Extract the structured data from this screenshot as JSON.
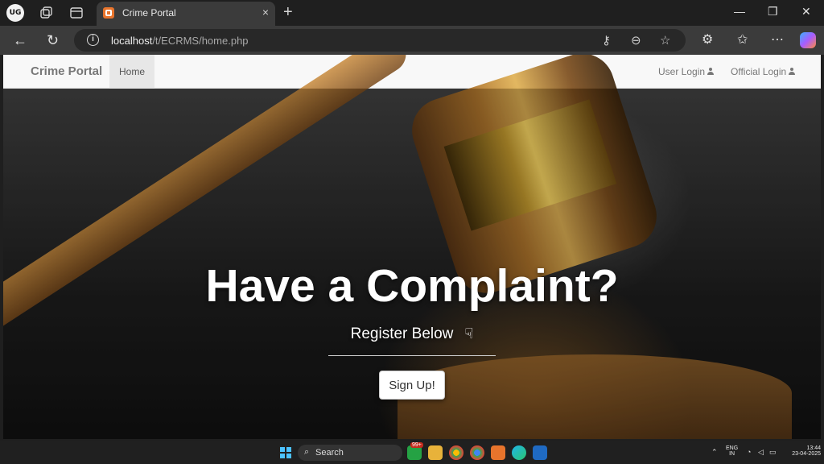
{
  "browser": {
    "profile_label": "UG",
    "tab": {
      "title": "Crime Portal",
      "close": "×"
    },
    "new_tab": "+",
    "window": {
      "minimize": "—",
      "maximize": "❐",
      "close": "✕"
    },
    "url_host": "localhost",
    "url_path": "/t/ECRMS/home.php"
  },
  "site": {
    "brand": "Crime Portal",
    "nav": {
      "home": "Home",
      "user_login": "User Login",
      "official_login": "Official Login"
    },
    "hero": {
      "title": "Have a Complaint?",
      "subtitle": "Register Below",
      "button": "Sign Up!"
    }
  },
  "taskbar": {
    "search_label": "Search",
    "badge": "99+",
    "lang_1": "ENG",
    "lang_2": "IN",
    "time": "13:44",
    "date": "23-04-2025"
  }
}
